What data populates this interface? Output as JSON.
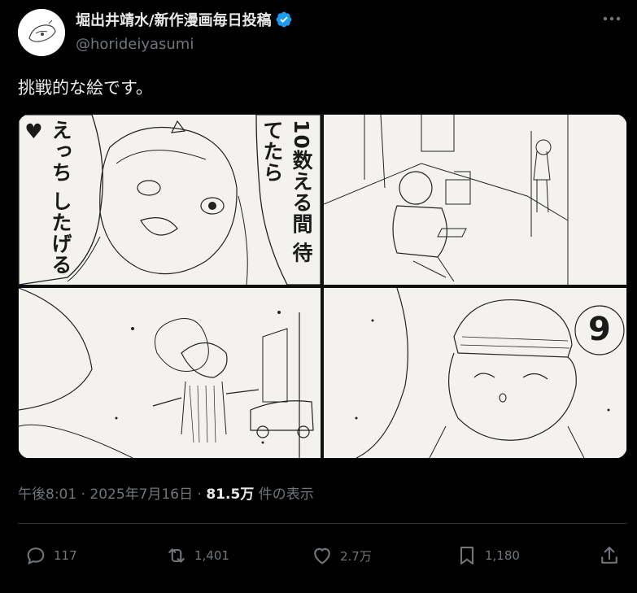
{
  "author": {
    "display_name": "堀出井靖水/新作漫画毎日投稿",
    "handle": "@horideiyasumi",
    "verified": true,
    "verified_color": "#1d9bf0"
  },
  "tweet": {
    "text": "挑戦的な絵です。"
  },
  "media": {
    "panel1": {
      "bubble_left": "えっち\nしたげる♥",
      "bubble_right": "10数える間\n待てたら"
    },
    "panel4": {
      "count": "9"
    }
  },
  "meta": {
    "time": "午後8:01",
    "separator1": " · ",
    "date": "2025年7月16日",
    "separator2": " · ",
    "views": "81.5万",
    "views_label": " 件の表示"
  },
  "actions": {
    "reply_count": "117",
    "retweet_count": "1,401",
    "like_count": "2.7万",
    "bookmark_count": "1,180"
  },
  "colors": {
    "background": "#000000",
    "text_primary": "#e7e9ea",
    "text_secondary": "#71767b",
    "divider": "#2f3336"
  },
  "icons": [
    "more-icon",
    "verified-badge-icon",
    "reply-icon",
    "retweet-icon",
    "like-icon",
    "bookmark-icon",
    "share-icon"
  ]
}
